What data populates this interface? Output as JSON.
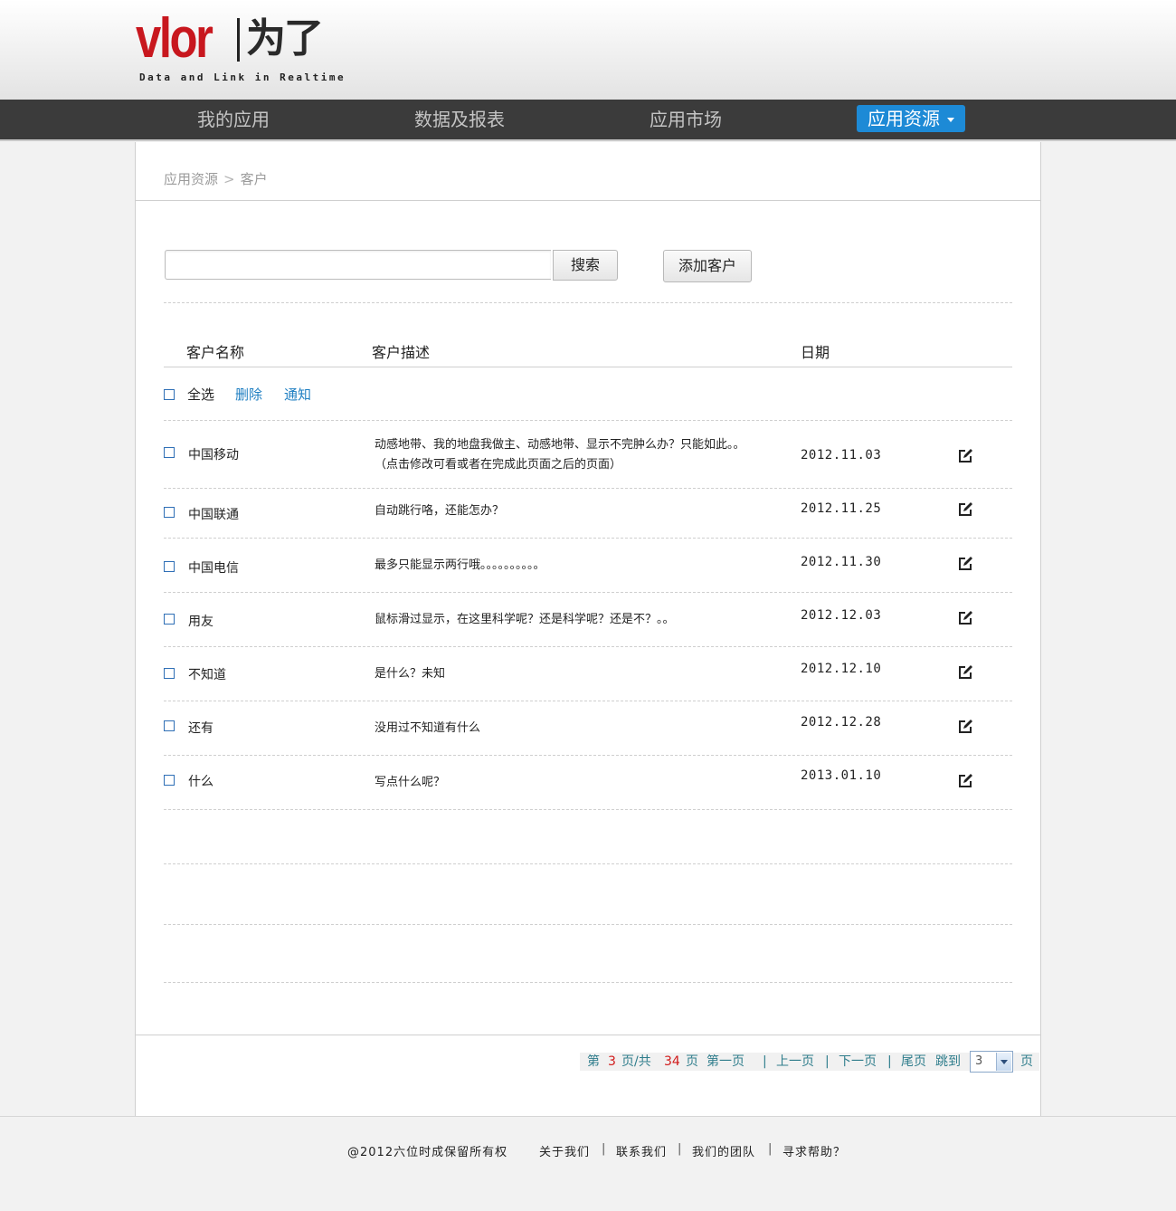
{
  "header": {
    "logo_latin": "vlor",
    "logo_cjk": "为了",
    "logo_tagline": "Data and Link in Realtime"
  },
  "nav": {
    "items": [
      {
        "label": "我的应用"
      },
      {
        "label": "数据及报表"
      },
      {
        "label": "应用市场"
      },
      {
        "label": "应用资源",
        "active": true
      }
    ],
    "active_color": "#1d8ad6"
  },
  "breadcrumb": {
    "items": [
      "应用资源",
      "客户"
    ],
    "separator": ">"
  },
  "search": {
    "value": "",
    "placeholder": "",
    "button_label": "搜索"
  },
  "add_customer_label": "添加客户",
  "table": {
    "columns": [
      "客户名称",
      "客户描述",
      "日期"
    ],
    "bulk": {
      "select_all": "全选",
      "delete": "删除",
      "notify": "通知"
    },
    "rows": [
      {
        "name": "中国移动",
        "description": "动感地带、我的地盘我做主、动感地带、显示不完肿么办？只能如此。。（点击修改可看或者在完成此页面之后的页面）",
        "date": "2012.11.03"
      },
      {
        "name": "中国联通",
        "description": "自动跳行咯，还能怎办？",
        "date": "2012.11.25"
      },
      {
        "name": "中国电信",
        "description": "最多只能显示两行哦。。。。。。。。。。",
        "date": "2012.11.30"
      },
      {
        "name": "用友",
        "description": "鼠标滑过显示，在这里科学呢？还是科学呢？还是不？。。",
        "date": "2012.12.03"
      },
      {
        "name": "不知道",
        "description": "是什么？未知",
        "date": "2012.12.10"
      },
      {
        "name": "还有",
        "description": "没用过不知道有什么",
        "date": "2012.12.28"
      },
      {
        "name": "什么",
        "description": "写点什么呢？",
        "date": "2013.01.10"
      }
    ]
  },
  "pagination": {
    "prefix": "第",
    "current_page": "3",
    "mid": "页/共",
    "total_pages": "34",
    "suffix": "页",
    "first": "第一页",
    "prev": "上一页",
    "next": "下一页",
    "last": "尾页",
    "jump_label": "跳到",
    "jump_value": "3",
    "jump_suffix": "页",
    "separator": "|"
  },
  "footer": {
    "copyright": "@2012六位时成保留所有权",
    "links": [
      "关于我们",
      "联系我们",
      "我们的团队",
      "寻求帮助？"
    ],
    "separator": "|"
  }
}
